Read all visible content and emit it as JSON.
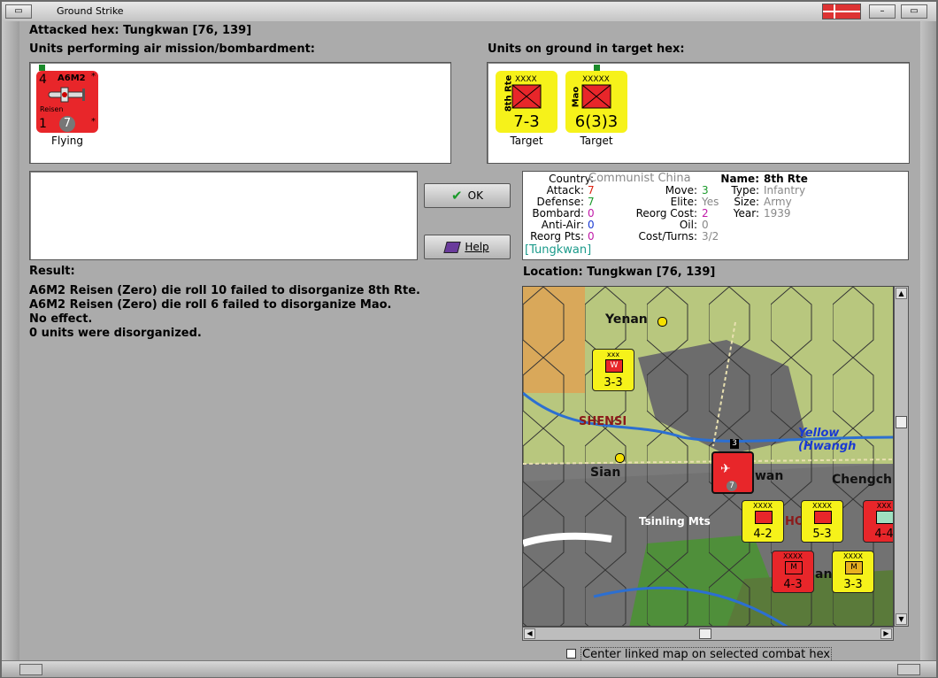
{
  "window": {
    "title": "Ground Strike"
  },
  "header": {
    "attacked_hex": "Attacked hex: Tungkwan  [76, 139]"
  },
  "air_panel": {
    "label": "Units performing air mission/bombardment:",
    "unit": {
      "top_left": "4",
      "type": "A6M2",
      "name": "Reisen",
      "bottom_left": "1",
      "badge": "7",
      "star": "*",
      "status": "Flying"
    }
  },
  "ground_panel": {
    "label": "Units on ground in target hex:",
    "units": [
      {
        "side_name": "8th Rte",
        "size": "XXXX",
        "strength": "7-3",
        "status": "Target"
      },
      {
        "side_name": "Mao",
        "size": "XXXXX",
        "strength": "6(3)3",
        "status": "Target"
      }
    ]
  },
  "buttons": {
    "ok": "OK",
    "help": "Help"
  },
  "unit_info": {
    "country_label": "Country:",
    "country": "Communist China",
    "attack_label": "Attack:",
    "attack": "7",
    "defense_label": "Defense:",
    "defense": "7",
    "bombard_label": "Bombard:",
    "bombard": "0",
    "antiair_label": "Anti-Air:",
    "antiair": "0",
    "reorg_label": "Reorg Pts:",
    "reorg": "0",
    "link": "[Tungkwan]",
    "move_label": "Move:",
    "move": "3",
    "elite_label": "Elite:",
    "elite": "Yes",
    "reorg_cost_label": "Reorg Cost:",
    "reorg_cost": "2",
    "oil_label": "Oil:",
    "oil": "0",
    "cost_turns_label": "Cost/Turns:",
    "cost_turns": "3/2",
    "name_label": "Name:",
    "name": "8th Rte",
    "type_label": "Type:",
    "type": "Infantry",
    "size_label": "Size:",
    "size": "Army",
    "year_label": "Year:",
    "year": "1939"
  },
  "result": {
    "label": "Result:",
    "lines": [
      "A6M2 Reisen (Zero) die roll 10 failed to disorganize 8th Rte.",
      "A6M2 Reisen (Zero) die roll 6 failed to disorganize Mao.",
      "No effect.",
      "0 units were disorganized."
    ]
  },
  "location": {
    "label": "Location:  Tungkwan  [76, 139]"
  },
  "map": {
    "places": [
      "Yenan",
      "SHENSI",
      "Sian",
      "Tsinling Mts",
      "wan",
      "Chengch",
      "Yellow (Hwangh",
      "an",
      "HO"
    ],
    "units": [
      {
        "label": "3-3",
        "size": "xxx",
        "sym": "W"
      },
      {
        "label": "4-2",
        "size": "XXXX",
        "sym": ""
      },
      {
        "label": "5-3",
        "size": "XXXX",
        "sym": ""
      },
      {
        "label": "4-4",
        "size": "XXX",
        "sym": ""
      },
      {
        "label": "4-3",
        "size": "XXXX",
        "sym": "M"
      },
      {
        "label": "3-3",
        "size": "XXXX",
        "sym": "M"
      },
      {
        "label": "3",
        "size": "",
        "sym": ""
      }
    ],
    "air_badge": "7"
  },
  "checkbox": {
    "label": "Center linked map on selected combat hex",
    "checked": false
  },
  "colors": {
    "red_unit": "#e8262a",
    "yellow_unit": "#f6f21a",
    "map_river": "#2c6fd1",
    "stack_red": "#8b1a1a"
  }
}
